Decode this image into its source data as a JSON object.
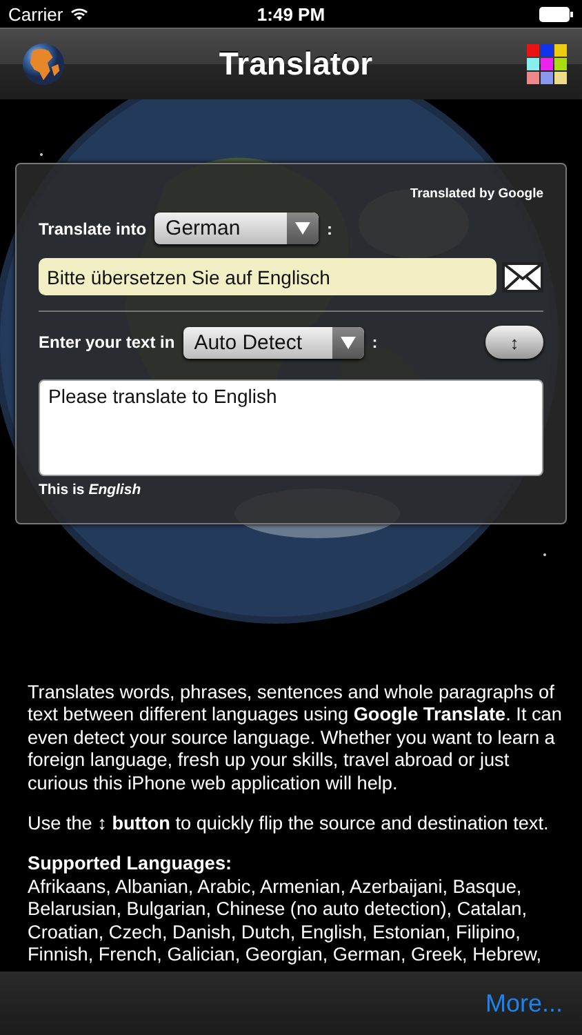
{
  "status_bar": {
    "carrier": "Carrier",
    "time": "1:49 PM"
  },
  "nav_bar": {
    "title": "Translator"
  },
  "panel": {
    "credit": "Translated by Google",
    "target": {
      "label": "Translate into",
      "value": "German",
      "colon": ":"
    },
    "output": "Bitte übersetzen Sie auf Englisch",
    "source": {
      "label": "Enter your text in",
      "value": "Auto Detect",
      "colon": ":"
    },
    "swap_button": "↕",
    "input": "Please translate to English",
    "detected": "This is *English*"
  },
  "description": [
    "Translates words, phrases, sentences and whole paragraphs of text between different languages using **Google Translate**. It can even detect your source language. Whether you want to learn a foreign language, fresh up your skills, travel abroad or just curious this iPhone web application will help.",
    "Use the **↕ button** to quickly flip the source and destination text."
  ],
  "languages": {
    "heading": "Supported Languages:",
    "text": "Afrikaans, Albanian, Arabic, Armenian, Azerbaijani, Basque, Belarusian, Bulgarian, Chinese (no auto detection), Catalan, Croatian, Czech, Danish, Dutch, English, Estonian, Filipino, Finnish, French, Galician, Georgian, German, Greek, Hebrew,"
  },
  "toolbar": {
    "more": "More..."
  }
}
